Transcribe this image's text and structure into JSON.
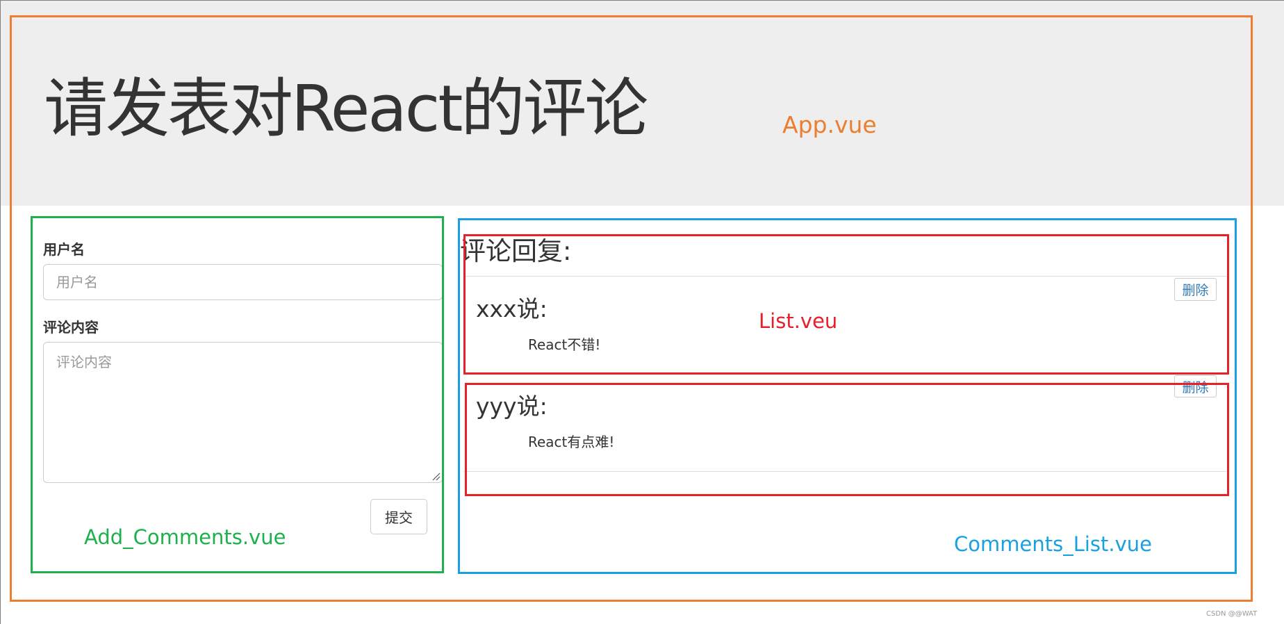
{
  "header": {
    "title": "请发表对React的评论"
  },
  "add_comment": {
    "username_label": "用户名",
    "username_placeholder": "用户名",
    "content_label": "评论内容",
    "content_placeholder": "评论内容",
    "submit_label": "提交"
  },
  "comment_list": {
    "heading": "评论回复:",
    "items": [
      {
        "user": "xxx说:",
        "text": "React不错!",
        "delete_label": "删除"
      },
      {
        "user": "yyy说:",
        "text": "React有点难!",
        "delete_label": "删除"
      }
    ]
  },
  "annotations": {
    "app": {
      "label": "App.vue",
      "color": "#ed7d31"
    },
    "add_comments": {
      "label": "Add_Comments.vue",
      "color": "#1db14b"
    },
    "comments_list": {
      "label": "Comments_List.vue",
      "color": "#19a0e0"
    },
    "list_item": {
      "label": "List.veu",
      "color": "#e8202a"
    }
  },
  "watermark": "CSDN @@WAT",
  "colors": {
    "header_background": "#eeeeee",
    "link_blue": "#337ab7",
    "text": "#333333"
  },
  "icons": {
    "resize_grip": "resize-grip-icon"
  }
}
